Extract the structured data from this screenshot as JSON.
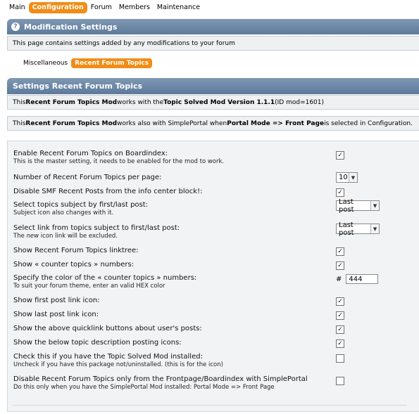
{
  "topnav": {
    "items": [
      "Main",
      "Configuration",
      "Forum",
      "Members",
      "Maintenance"
    ],
    "active": "Configuration"
  },
  "modification_settings": {
    "title": "Modification Settings",
    "description": "This page contains settings added by any modifications to your forum"
  },
  "subtabs": {
    "items": [
      "Miscellaneous",
      "Recent Forum Topics"
    ],
    "active": "Recent Forum Topics"
  },
  "settings_header": "Settings Recent Forum Topics",
  "info1": {
    "pre": "This ",
    "mod": "Recent Forum Topics Mod",
    "mid": " works with the ",
    "solved": "Topic Solved Mod Version 1.1.1",
    "post": " (ID mod=1601)"
  },
  "info2": {
    "pre": "This ",
    "mod": "Recent Forum Topics Mod",
    "mid": " works also with SimplePortal when ",
    "mode": "Portal Mode => Front Page",
    "post": " is selected in Configuration."
  },
  "settings": {
    "enable": {
      "label": "Enable Recent Forum Topics on Boardindex:",
      "sub": "This is the master setting, it needs to be enabled for the mod to work.",
      "checked": true
    },
    "per_page": {
      "label": "Number of Recent Forum Topics per page:",
      "value": "10"
    },
    "disable_smf": {
      "label": "Disable SMF Recent Posts from the info center block!:",
      "checked": true
    },
    "subject": {
      "label": "Select topics subject by first/last post:",
      "sub": "Subject icon also changes with it.",
      "value": "Last post"
    },
    "link": {
      "label": "Select link from topics subject to first/last post:",
      "sub_pre": "The ",
      "sub_em": "new",
      "sub_post": " icon link will be excluded.",
      "value": "Last post"
    },
    "linktree": {
      "label": "Show Recent Forum Topics linktree:",
      "checked": true
    },
    "counter": {
      "label": "Show « counter topics » numbers:",
      "checked": true
    },
    "color": {
      "label": "Specify the color of the « counter topics » numbers:",
      "sub": "To suit your forum theme, enter an valid HEX color",
      "hash": "#",
      "value": "444"
    },
    "first_icon": {
      "label": "Show first post link icon:",
      "checked": true
    },
    "last_icon": {
      "label": "Show last post link icon:",
      "checked": true
    },
    "quicklink": {
      "label": "Show the above quicklink buttons about user's posts:",
      "checked": true
    },
    "desc_icons": {
      "label": "Show the below topic description posting icons:",
      "checked": true
    },
    "solved": {
      "label": "Check this if you have the Topic Solved Mod installed:",
      "sub": "Uncheck if you have this package not/uninstalled. (this is for the icon)",
      "checked": false
    },
    "frontpage": {
      "label": "Disable Recent Forum Topics only from the Frontpage/Boardindex with SimplePortal",
      "sub": "Do this only when you have the SimplePortal Mod installed: Portal Mode => Front Page",
      "checked": false
    }
  },
  "icons": {
    "help": "question-mark-icon",
    "check": "checkmark-icon",
    "dropdown": "chevron-down-icon"
  }
}
